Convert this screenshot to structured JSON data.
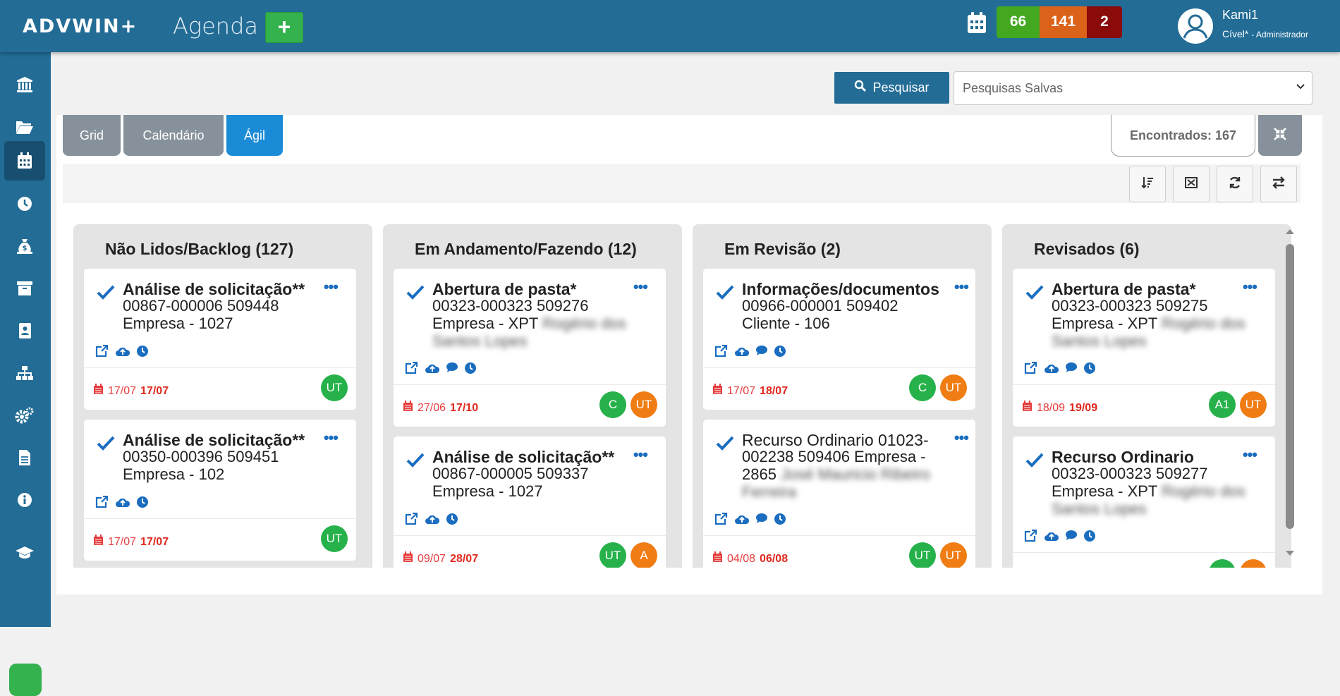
{
  "header": {
    "logo": "ADVWIN+",
    "app_title": "Agenda",
    "add_label": "+",
    "counters": [
      "66",
      "141",
      "2"
    ],
    "user_name": "Kami1",
    "user_area": "Cível*",
    "user_role": "- Administrador"
  },
  "colors": {
    "topbar": "#226c96",
    "green": "#43a81f",
    "orange": "#db6319",
    "red": "#8b0a0a",
    "tab_active": "#1a8bd6",
    "tab": "#86919b"
  },
  "sidebar": {
    "icons": [
      "bank-icon",
      "folder-icon",
      "calendar-icon",
      "clock-icon",
      "money-bag-icon",
      "archive-icon",
      "contact-book-icon",
      "sitemap-icon",
      "cogs-icon",
      "document-icon",
      "info-icon",
      "graduation-cap-icon"
    ]
  },
  "search": {
    "button_label": "Pesquisar",
    "saved_placeholder": "Pesquisas Salvas"
  },
  "tabs": [
    "Grid",
    "Calendário",
    "Ágil"
  ],
  "found_label": "Encontrados: 167",
  "columns": [
    {
      "title": "Não Lidos/Backlog (127)",
      "cards": [
        {
          "title": "Análise de solicitação**",
          "lines": [
            "00867-000006 509448",
            "Empresa - 1027"
          ],
          "blur": "",
          "date_start": "17/07",
          "date_end": "17/07",
          "avatars": [
            "UT"
          ]
        },
        {
          "title": "Análise de solicitação**",
          "lines": [
            "00350-000396 509451",
            "Empresa - 102"
          ],
          "blur": "",
          "date_start": "17/07",
          "date_end": "17/07",
          "avatars": [
            "UT"
          ]
        }
      ]
    },
    {
      "title": "Em Andamento/Fazendo (12)",
      "cards": [
        {
          "title": "Abertura de pasta*",
          "lines": [
            "00323-000323 509276",
            "Empresa - XPT"
          ],
          "blur": "Rogério dos Santos Lopes",
          "date_start": "27/06",
          "date_end": "17/10",
          "avatars": [
            "C",
            "UT"
          ]
        },
        {
          "title": "Análise de solicitação**",
          "lines": [
            "00867-000005 509337",
            "Empresa - 1027"
          ],
          "blur": "",
          "date_start": "09/07",
          "date_end": "28/07",
          "avatars": [
            "UT",
            "A"
          ]
        }
      ]
    },
    {
      "title": "Em Revisão (2)",
      "cards": [
        {
          "title": "Informações/documentos",
          "lines": [
            "00966-000001 509402",
            "Cliente - 106"
          ],
          "blur": "",
          "date_start": "17/07",
          "date_end": "18/07",
          "avatars": [
            "C",
            "UT"
          ]
        },
        {
          "title": "Recurso Ordinario 01023-",
          "lines": [
            "002238 509406 Empresa -",
            "2865"
          ],
          "blur": "José Mauricio Ribeiro Ferreira",
          "date_start": "04/08",
          "date_end": "06/08",
          "avatars": [
            "UT",
            "UT"
          ]
        }
      ]
    },
    {
      "title": "Revisados (6)",
      "cards": [
        {
          "title": "Abertura de pasta*",
          "lines": [
            "00323-000323 509275",
            "Empresa - XPT"
          ],
          "blur": "Rogério dos Santos Lopes",
          "date_start": "18/09",
          "date_end": "19/09",
          "avatars": [
            "A1",
            "UT"
          ]
        },
        {
          "title": "Recurso Ordinario",
          "lines": [
            "00323-000323 509277",
            "Empresa - XPT"
          ],
          "blur": "Rogério dos Santos Lopes",
          "date_start": "",
          "date_end": "",
          "avatars": []
        }
      ]
    }
  ]
}
